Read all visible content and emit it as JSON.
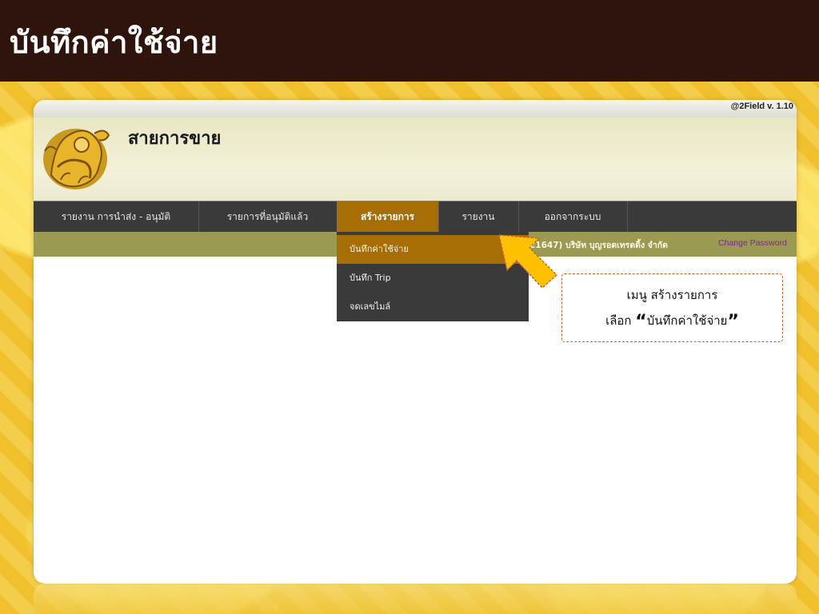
{
  "slide": {
    "title": "บันทึกค่าใช้จ่าย"
  },
  "app": {
    "version": "@2Field v. 1.10",
    "banner_title": "สายการขาย",
    "logo_icon": "lion-emblem-icon"
  },
  "nav": {
    "items": [
      {
        "label": "รายงาน การนำส่ง - อนุมัติ"
      },
      {
        "label": "รายการที่อนุมัติแล้ว"
      },
      {
        "label": "สร้างรายการ",
        "active": true
      },
      {
        "label": "รายงาน"
      },
      {
        "label": "ออกจากระบบ"
      }
    ]
  },
  "user_bar": {
    "info": "21647) บริษัท บุญรอดเทรดดิ้ง จำกัด",
    "change_password": "Change Password"
  },
  "dropdown": {
    "items": [
      {
        "label": "บันทึกค่าใช้จ่าย",
        "highlight": true
      },
      {
        "label": "บันทึก Trip"
      },
      {
        "label": "จดเลขไมล์"
      }
    ]
  },
  "callout": {
    "line1": "เมนู สร้างรายการ",
    "line2_prefix": "เลือก ",
    "open_quote": "“",
    "line2_target": "บันทึกค่าใช้จ่าย",
    "close_quote": "”"
  },
  "colors": {
    "header_bg": "#2e140d",
    "nav_bg": "#3a3a3a",
    "accent": "#a66e05",
    "subbar": "#9a9a52",
    "arrow": "#ffc000",
    "callout_border": "#c8632a"
  },
  "icons": {
    "pointer": "arrow-pointer-icon"
  }
}
